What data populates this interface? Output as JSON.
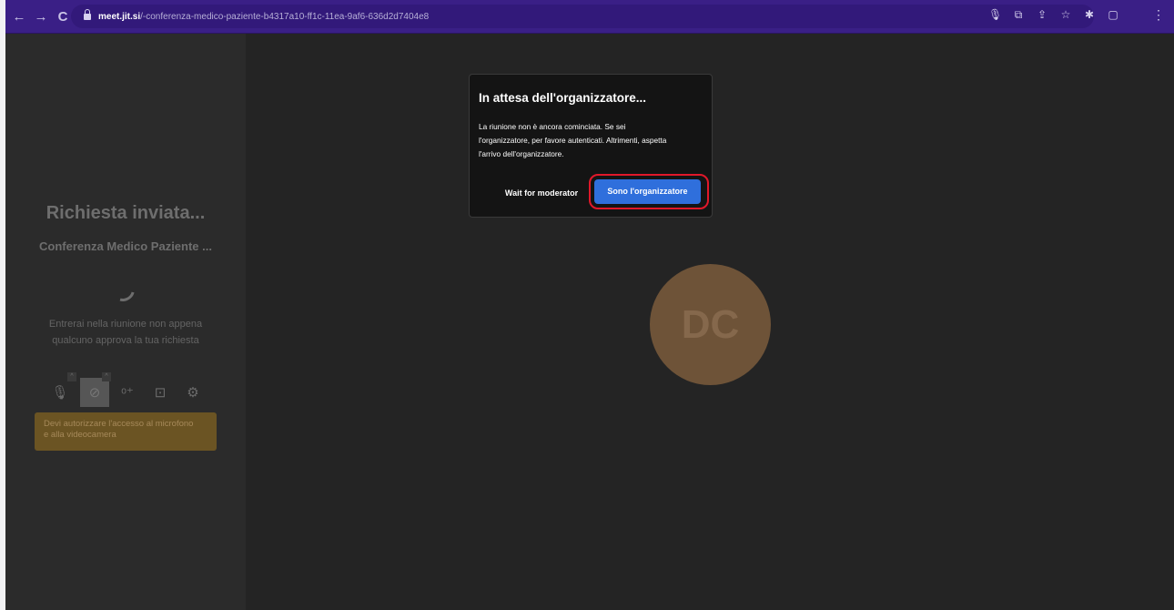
{
  "browser": {
    "url_host": "meet.jit.si",
    "url_path": "/-conferenza-medico-paziente-b4317a10-ff1c-11ea-9af6-636d2d7404e8",
    "icons": [
      "back-icon",
      "forward-icon",
      "reload-icon",
      "lock-icon",
      "mic-icon",
      "cast-icon",
      "share-icon",
      "star-icon",
      "extensions-icon",
      "sidepanel-icon",
      "menu-icon"
    ]
  },
  "left_panel": {
    "title": "Richiesta inviata...",
    "subtitle": "Conferenza Medico Paziente ...",
    "message_line1": "Entrerai nella riunione non appena",
    "message_line2": "qualcuno approva la tua richiesta",
    "warning_line1": "Devi autorizzare l'accesso al microfono",
    "warning_line2": "e alla videocamera"
  },
  "avatar": {
    "initials": "DC"
  },
  "dialog": {
    "title": "In attesa dell'organizzatore...",
    "text_line1": "La riunione non è ancora cominciata. Se sei",
    "text_line2": "l'organizzatore, per favore autenticati. Altrimenti, aspetta",
    "text_line3": "l'arrivo dell'organizzatore.",
    "wait_button": "Wait for moderator",
    "host_button": "Sono l'organizzatore"
  },
  "colors": {
    "toolbar": "#3a1f86",
    "background": "#242424",
    "primary_button": "#2f6fdc",
    "highlight_ring": "#e0182a",
    "avatar": "#6e5338",
    "warning": "#6b5423"
  }
}
